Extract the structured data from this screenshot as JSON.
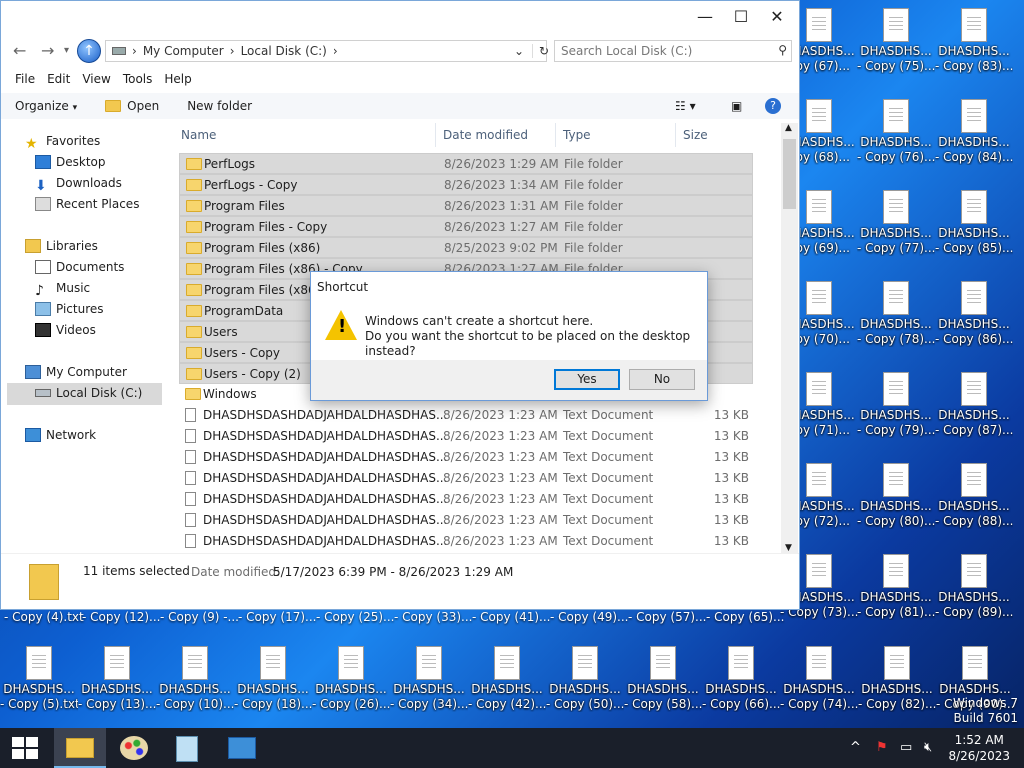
{
  "explorer": {
    "window_controls": {
      "minimize": "—",
      "maximize": "☐",
      "close": "✕"
    },
    "breadcrumb": [
      "My Computer",
      "Local Disk (C:)"
    ],
    "search_placeholder": "Search Local Disk (C:)",
    "menu": [
      "File",
      "Edit",
      "View",
      "Tools",
      "Help"
    ],
    "toolbar": {
      "organize": "Organize",
      "open": "Open",
      "new_folder": "New folder"
    },
    "nav": {
      "favorites": "Favorites",
      "desktop": "Desktop",
      "downloads": "Downloads",
      "recent": "Recent Places",
      "libraries": "Libraries",
      "documents": "Documents",
      "music": "Music",
      "pictures": "Pictures",
      "videos": "Videos",
      "computer": "My Computer",
      "local_disk": "Local Disk (C:)",
      "network": "Network"
    },
    "columns": {
      "name": "Name",
      "date": "Date modified",
      "type": "Type",
      "size": "Size"
    },
    "rows": [
      {
        "name": "PerfLogs",
        "date": "8/26/2023 1:29 AM",
        "type": "File folder",
        "size": ""
      },
      {
        "name": "PerfLogs - Copy",
        "date": "8/26/2023 1:34 AM",
        "type": "File folder",
        "size": ""
      },
      {
        "name": "Program Files",
        "date": "8/26/2023 1:31 AM",
        "type": "File folder",
        "size": ""
      },
      {
        "name": "Program Files - Copy",
        "date": "8/26/2023 1:27 AM",
        "type": "File folder",
        "size": ""
      },
      {
        "name": "Program Files (x86)",
        "date": "8/25/2023 9:02 PM",
        "type": "File folder",
        "size": ""
      },
      {
        "name": "Program Files (x86) - Copy",
        "date": "8/26/2023 1:27 AM",
        "type": "File folder",
        "size": ""
      },
      {
        "name": "Program Files (x86) - Copy (2)",
        "date": "",
        "type": "",
        "size": ""
      },
      {
        "name": "ProgramData",
        "date": "",
        "type": "",
        "size": ""
      },
      {
        "name": "Users",
        "date": "",
        "type": "",
        "size": ""
      },
      {
        "name": "Users - Copy",
        "date": "",
        "type": "",
        "size": ""
      },
      {
        "name": "Users - Copy (2)",
        "date": "",
        "type": "",
        "size": ""
      },
      {
        "name": "Windows",
        "date": "",
        "type": "",
        "size": ""
      },
      {
        "name": "DHASDHSDASHDADJAHDALDHASDHAS...",
        "date": "8/26/2023 1:23 AM",
        "type": "Text Document",
        "size": "13 KB"
      },
      {
        "name": "DHASDHSDASHDADJAHDALDHASDHAS...",
        "date": "8/26/2023 1:23 AM",
        "type": "Text Document",
        "size": "13 KB"
      },
      {
        "name": "DHASDHSDASHDADJAHDALDHASDHAS...",
        "date": "8/26/2023 1:23 AM",
        "type": "Text Document",
        "size": "13 KB"
      },
      {
        "name": "DHASDHSDASHDADJAHDALDHASDHAS...",
        "date": "8/26/2023 1:23 AM",
        "type": "Text Document",
        "size": "13 KB"
      },
      {
        "name": "DHASDHSDASHDADJAHDALDHASDHAS...",
        "date": "8/26/2023 1:23 AM",
        "type": "Text Document",
        "size": "13 KB"
      },
      {
        "name": "DHASDHSDASHDADJAHDALDHASDHAS...",
        "date": "8/26/2023 1:23 AM",
        "type": "Text Document",
        "size": "13 KB"
      },
      {
        "name": "DHASDHSDASHDADJAHDALDHASDHAS...",
        "date": "8/26/2023 1:23 AM",
        "type": "Text Document",
        "size": "13 KB"
      }
    ],
    "details": {
      "count": "11 items selected",
      "label": "Date modified:",
      "range": "5/17/2023 6:39 PM - 8/26/2023 1:29 AM"
    }
  },
  "dialog": {
    "title": "Shortcut",
    "line1": "Windows can't create a shortcut here.",
    "line2": "Do you want the shortcut to be placed on the desktop instead?",
    "yes": "Yes",
    "no": "No"
  },
  "desktop": {
    "icon_name": "DHASDHS...",
    "right_col1": [
      "opy (67)...",
      "opy (68)...",
      "opy (69)...",
      "opy (70)...",
      "opy (71)...",
      "opy (72)..."
    ],
    "right_col2": [
      "- Copy (75)...",
      "- Copy (76)...",
      "- Copy (77)...",
      "- Copy (78)...",
      "- Copy (79)...",
      "- Copy (80)...",
      "- Copy (81)..."
    ],
    "right_col3": [
      "- Copy (83)...",
      "- Copy (84)...",
      "- Copy (85)...",
      "- Copy (86)...",
      "- Copy (87)...",
      "- Copy (88)...",
      "- Copy (89)..."
    ],
    "right_col1_row7": "- Copy (73)...",
    "bottom_row1": [
      "- Copy (4).txt",
      "- Copy (12)...",
      "- Copy (9) -...",
      "- Copy (17)...",
      "- Copy (25)...",
      "- Copy (33)...",
      "- Copy (41)...",
      "- Copy (49)...",
      "- Copy (57)...",
      "- Copy (65)..."
    ],
    "bottom_row2": [
      "- Copy (5).txt",
      "- Copy (13)...",
      "- Copy (10)...",
      "- Copy (18)...",
      "- Copy (26)...",
      "- Copy (34)...",
      "- Copy (42)...",
      "- Copy (50)...",
      "- Copy (58)...",
      "- Copy (66)...",
      "- Copy (74)...",
      "- Copy (82)...",
      "- Copy (90)..."
    ],
    "watermark_line1": "Windows 7",
    "watermark_line2": "Build 7601"
  },
  "taskbar": {
    "time": "1:52 AM",
    "date": "8/26/2023"
  }
}
